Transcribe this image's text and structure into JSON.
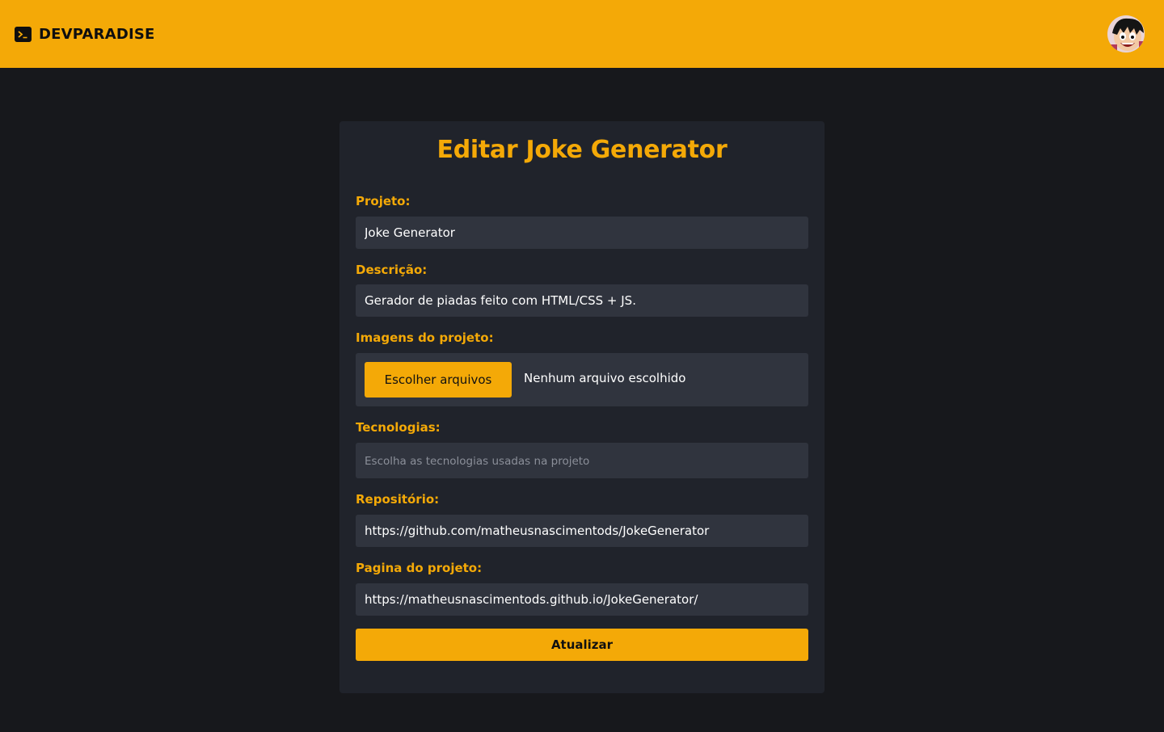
{
  "header": {
    "brand": "DEVPARADISE",
    "brand_icon": "terminal-icon",
    "avatar_icon": "user-avatar"
  },
  "form": {
    "title": "Editar Joke Generator",
    "project_label": "Projeto:",
    "project_value": "Joke Generator",
    "description_label": "Descrição:",
    "description_value": "Gerador de piadas feito com HTML/CSS + JS.",
    "images_label": "Imagens do projeto:",
    "choose_files_label": "Escolher arquivos",
    "no_file_text": "Nenhum arquivo escolhido",
    "technologies_label": "Tecnologias:",
    "technologies_placeholder": "Escolha as tecnologias usadas na projeto",
    "repository_label": "Repositório:",
    "repository_value": "https://github.com/matheusnascimentods/JokeGenerator",
    "page_label": "Pagina do projeto:",
    "page_value": "https://matheusnascimentods.github.io/JokeGenerator/",
    "submit_label": "Atualizar"
  },
  "colors": {
    "accent": "#f4a907",
    "background": "#17181c",
    "card": "#20232b",
    "input": "#30343e"
  }
}
